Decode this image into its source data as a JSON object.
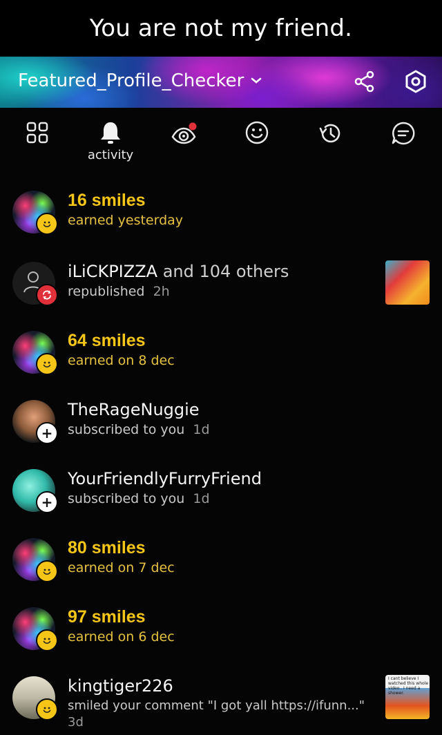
{
  "caption": "You are not my friend.",
  "header": {
    "title": "Featured_Profile_Checker",
    "share_icon": "share-icon",
    "settings_icon": "settings-hex-icon"
  },
  "tabs": [
    {
      "name": "grid",
      "icon": "grid-icon",
      "label": ""
    },
    {
      "name": "activity",
      "icon": "bell-icon",
      "label": "activity",
      "active": true
    },
    {
      "name": "views",
      "icon": "eye-icon",
      "label": "",
      "notification_dot": true
    },
    {
      "name": "smiles",
      "icon": "smiley-icon",
      "label": ""
    },
    {
      "name": "history",
      "icon": "history-icon",
      "label": ""
    },
    {
      "name": "chat",
      "icon": "chat-icon",
      "label": ""
    }
  ],
  "colors": {
    "accent": "#f5c518",
    "repub_badge": "#e0303a",
    "dot": "#e0303a"
  },
  "activity": [
    {
      "title": "16 smiles",
      "sub": "earned yesterday",
      "time": "",
      "kind": "smiles",
      "badge": "smile"
    },
    {
      "title": "iLiCKPIZZA",
      "title_extra": " and 104 others",
      "sub": "republished",
      "time": "2h",
      "kind": "repub",
      "badge": "repub"
    },
    {
      "title": "64 smiles",
      "sub": "earned on 8 dec",
      "time": "",
      "kind": "smiles",
      "badge": "smile"
    },
    {
      "title": "TheRageNuggie",
      "sub": "subscribed to you",
      "time": "1d",
      "kind": "sub",
      "badge": "plus"
    },
    {
      "title": "YourFriendlyFurryFriend",
      "sub": "subscribed to you",
      "time": "1d",
      "kind": "sub",
      "badge": "plus"
    },
    {
      "title": "80 smiles",
      "sub": "earned on 7 dec",
      "time": "",
      "kind": "smiles",
      "badge": "smile"
    },
    {
      "title": "97 smiles",
      "sub": "earned on 6 dec",
      "time": "",
      "kind": "smiles",
      "badge": "smile"
    },
    {
      "title": "kingtiger226",
      "sub": "smiled your comment \"I got yall https://ifunn...\"",
      "time": "3d",
      "kind": "smiled",
      "badge": "smile"
    }
  ],
  "thumb_last_caption": "I cant believe I watched this whole video.. I need a shower."
}
